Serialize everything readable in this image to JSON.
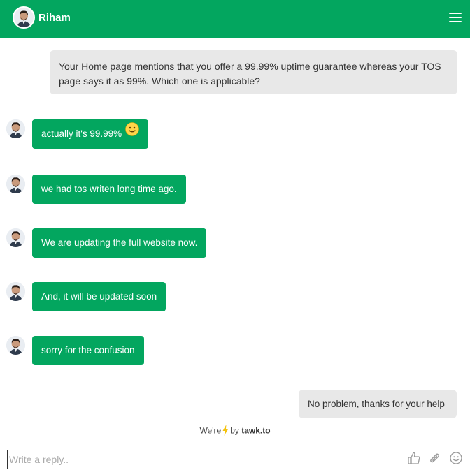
{
  "header": {
    "agent_name": "Riham",
    "avatar_icon": "agent-avatar",
    "menu_icon": "hamburger-menu-icon",
    "color": "#03a65f"
  },
  "messages": {
    "visitor_1": "Your Home page mentions that you offer a 99.99% uptime guarantee whereas your TOS page says it as 99%. Which one is applicable?",
    "agent": [
      {
        "text": "actually it's 99.99%",
        "emoji": "slightly-smiling-face"
      },
      {
        "text": "we had tos writen long time ago."
      },
      {
        "text": "We are updating the full website now."
      },
      {
        "text": "And, it will be updated soon"
      },
      {
        "text": "sorry for the confusion"
      }
    ],
    "visitor_2": "No problem, thanks for your help"
  },
  "footer": {
    "powered_prefix": "We're",
    "powered_by": "by",
    "brand": "tawk.to",
    "reply_placeholder": "Write a reply..",
    "icons": [
      "thumbs-up-icon",
      "paperclip-icon",
      "emoji-icon"
    ]
  }
}
